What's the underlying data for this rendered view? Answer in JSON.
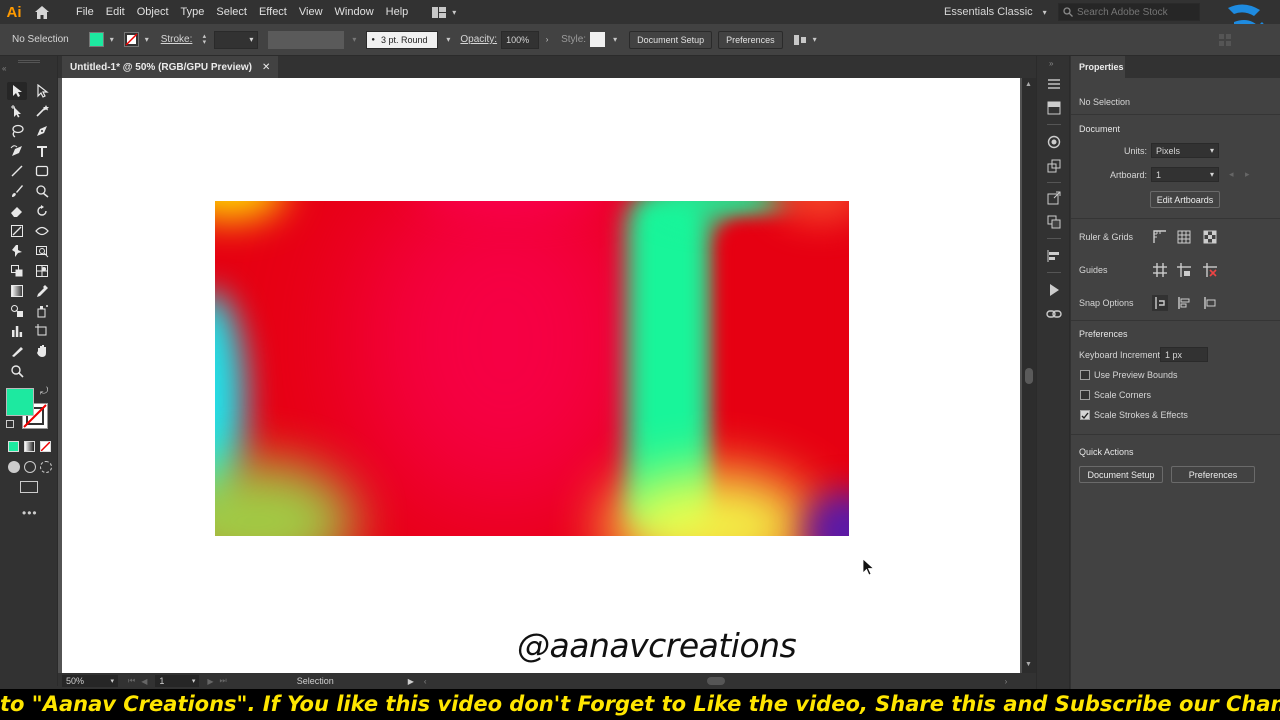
{
  "app": {
    "logo_text": "Ai",
    "menu": [
      "File",
      "Edit",
      "Object",
      "Type",
      "Select",
      "Effect",
      "View",
      "Window",
      "Help"
    ],
    "workspace": "Essentials Classic",
    "search_placeholder": "Search Adobe Stock"
  },
  "control_bar": {
    "selection_label": "No Selection",
    "fill_color": "#1de9a0",
    "stroke_label": "Stroke:",
    "brush_label": "3 pt. Round",
    "opacity_label": "Opacity:",
    "opacity_value": "100%",
    "style_label": "Style:",
    "doc_setup_label": "Document Setup",
    "preferences_label": "Preferences"
  },
  "document": {
    "tab_title": "Untitled-1* @ 50% (RGB/GPU Preview)",
    "tab_close": "✕",
    "watermark": "@aanavcreations"
  },
  "status_bar": {
    "zoom": "50%",
    "artboard_num": "1",
    "tool_name": "Selection"
  },
  "toolbar": {
    "fill_color": "#1de9a0"
  },
  "properties": {
    "tab_label": "Properties",
    "selection_state": "No Selection",
    "document_heading": "Document",
    "units_label": "Units:",
    "units_value": "Pixels",
    "artboard_label": "Artboard:",
    "artboard_value": "1",
    "edit_artboards_label": "Edit Artboards",
    "ruler_grids_label": "Ruler & Grids",
    "guides_label": "Guides",
    "snap_options_label": "Snap Options",
    "preferences_heading": "Preferences",
    "keyboard_increment_label": "Keyboard Increment:",
    "keyboard_increment_value": "1 px",
    "use_preview_bounds": {
      "label": "Use Preview Bounds",
      "checked": false
    },
    "scale_corners": {
      "label": "Scale Corners",
      "checked": false
    },
    "scale_strokes": {
      "label": "Scale Strokes & Effects",
      "checked": true
    },
    "quick_actions_heading": "Quick Actions",
    "qa_doc_setup_label": "Document Setup",
    "qa_preferences_label": "Preferences"
  },
  "banner": {
    "text": "to \"Aanav Creations\". If You like this video don't Forget to Like the video, Share this and Subscribe our Channel....."
  },
  "colors": {
    "mesh_base": "#e60012",
    "mesh_pink": "#ff0060",
    "mesh_green": "#18f59a",
    "mesh_yellow": "#f4ff4a",
    "mesh_cyan": "#20e0e8",
    "mesh_purple": "#5a1aa8",
    "banner_text": "#ffe600"
  }
}
